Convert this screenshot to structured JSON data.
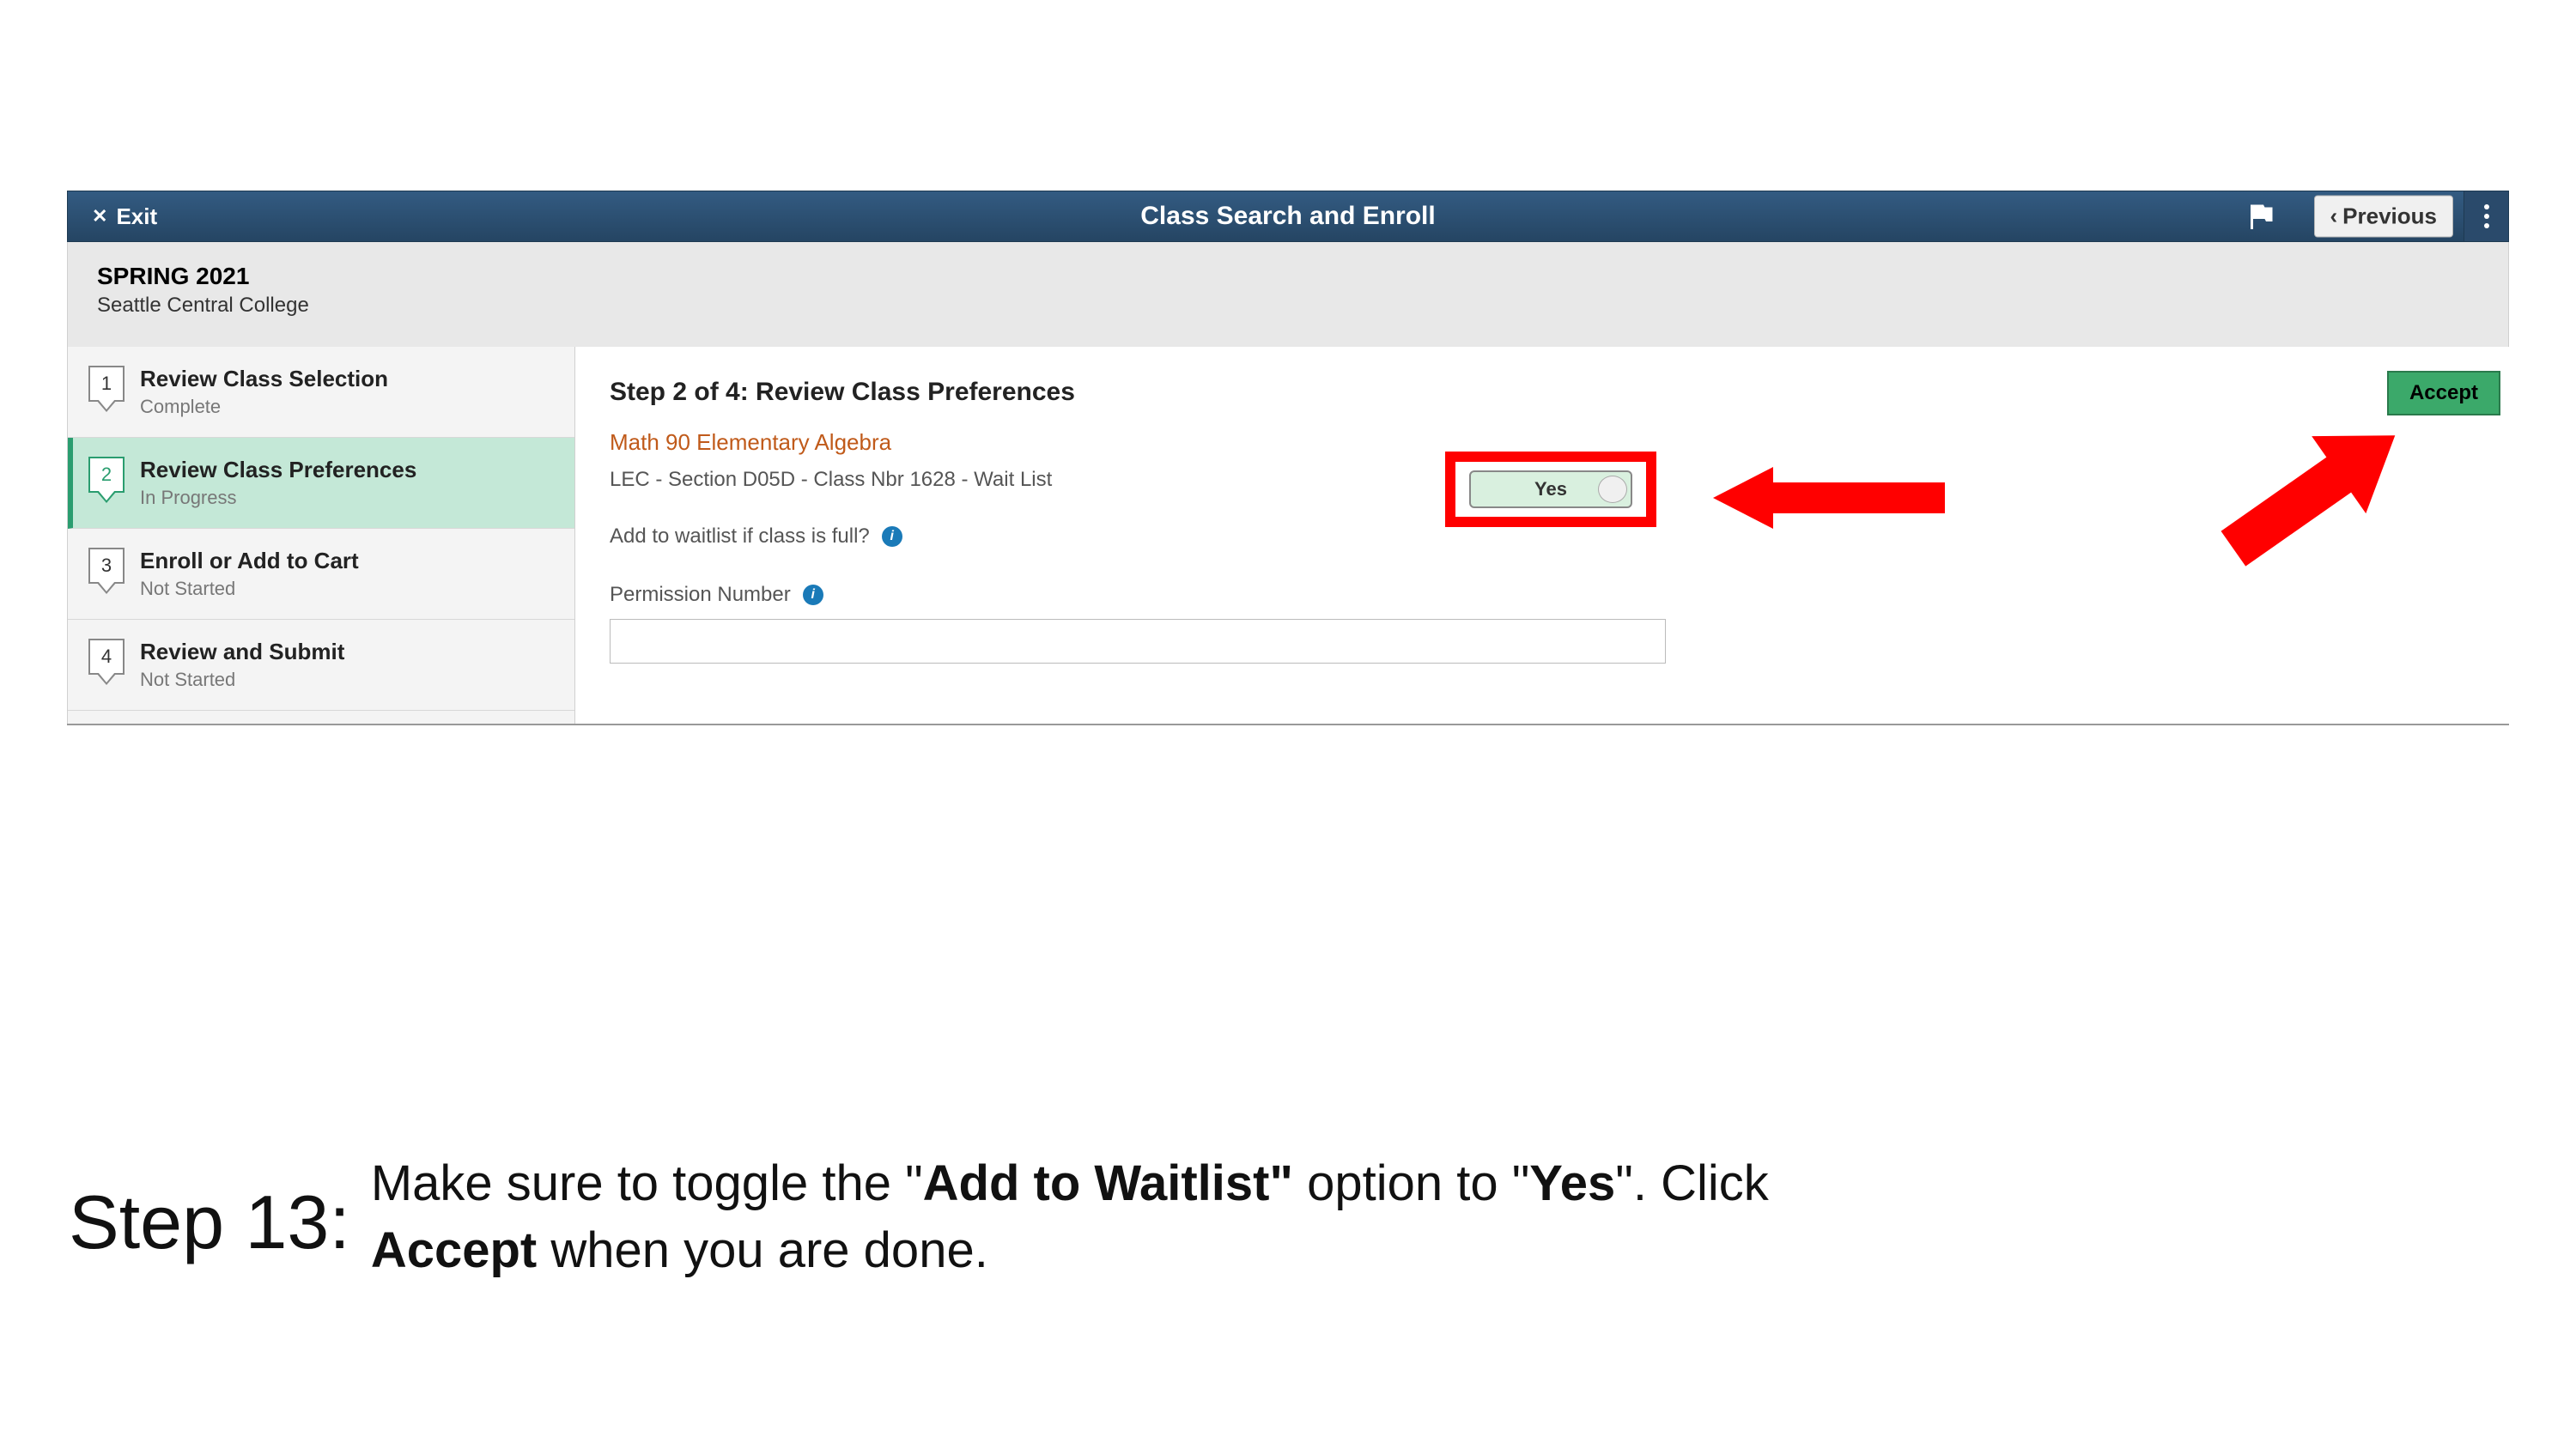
{
  "header": {
    "exit_label": "Exit",
    "title": "Class Search and Enroll",
    "previous_label": "Previous"
  },
  "subheader": {
    "term": "SPRING 2021",
    "college": "Seattle Central College"
  },
  "steps": [
    {
      "num": "1",
      "title": "Review Class Selection",
      "status": "Complete",
      "active": false
    },
    {
      "num": "2",
      "title": "Review Class Preferences",
      "status": "In Progress",
      "active": true
    },
    {
      "num": "3",
      "title": "Enroll or Add to Cart",
      "status": "Not Started",
      "active": false
    },
    {
      "num": "4",
      "title": "Review and Submit",
      "status": "Not Started",
      "active": false
    }
  ],
  "main": {
    "heading": "Step 2 of 4: Review Class Preferences",
    "class_name": "Math 90  Elementary Algebra",
    "class_detail": "LEC - Section D05D - Class Nbr 1628 - Wait List",
    "waitlist_label": "Add to waitlist if class is full?",
    "toggle_value": "Yes",
    "permission_label": "Permission Number",
    "permission_value": "",
    "accept_label": "Accept"
  },
  "annotation": {
    "step_label": "Step 13:",
    "line1_a": "Make sure to toggle the \"",
    "line1_b": "Add to Waitlist\"",
    "line1_c": " option to \"",
    "line1_d": "Yes",
    "line1_e": "\". Click ",
    "line2_a": "Accept",
    "line2_b": " when you are done."
  },
  "colors": {
    "header_bg": "#2a4a6b",
    "accent_green": "#3ba96a",
    "step_active_bg": "#c4e8d7",
    "highlight_red": "#ff0000",
    "class_link": "#c05a1a"
  }
}
